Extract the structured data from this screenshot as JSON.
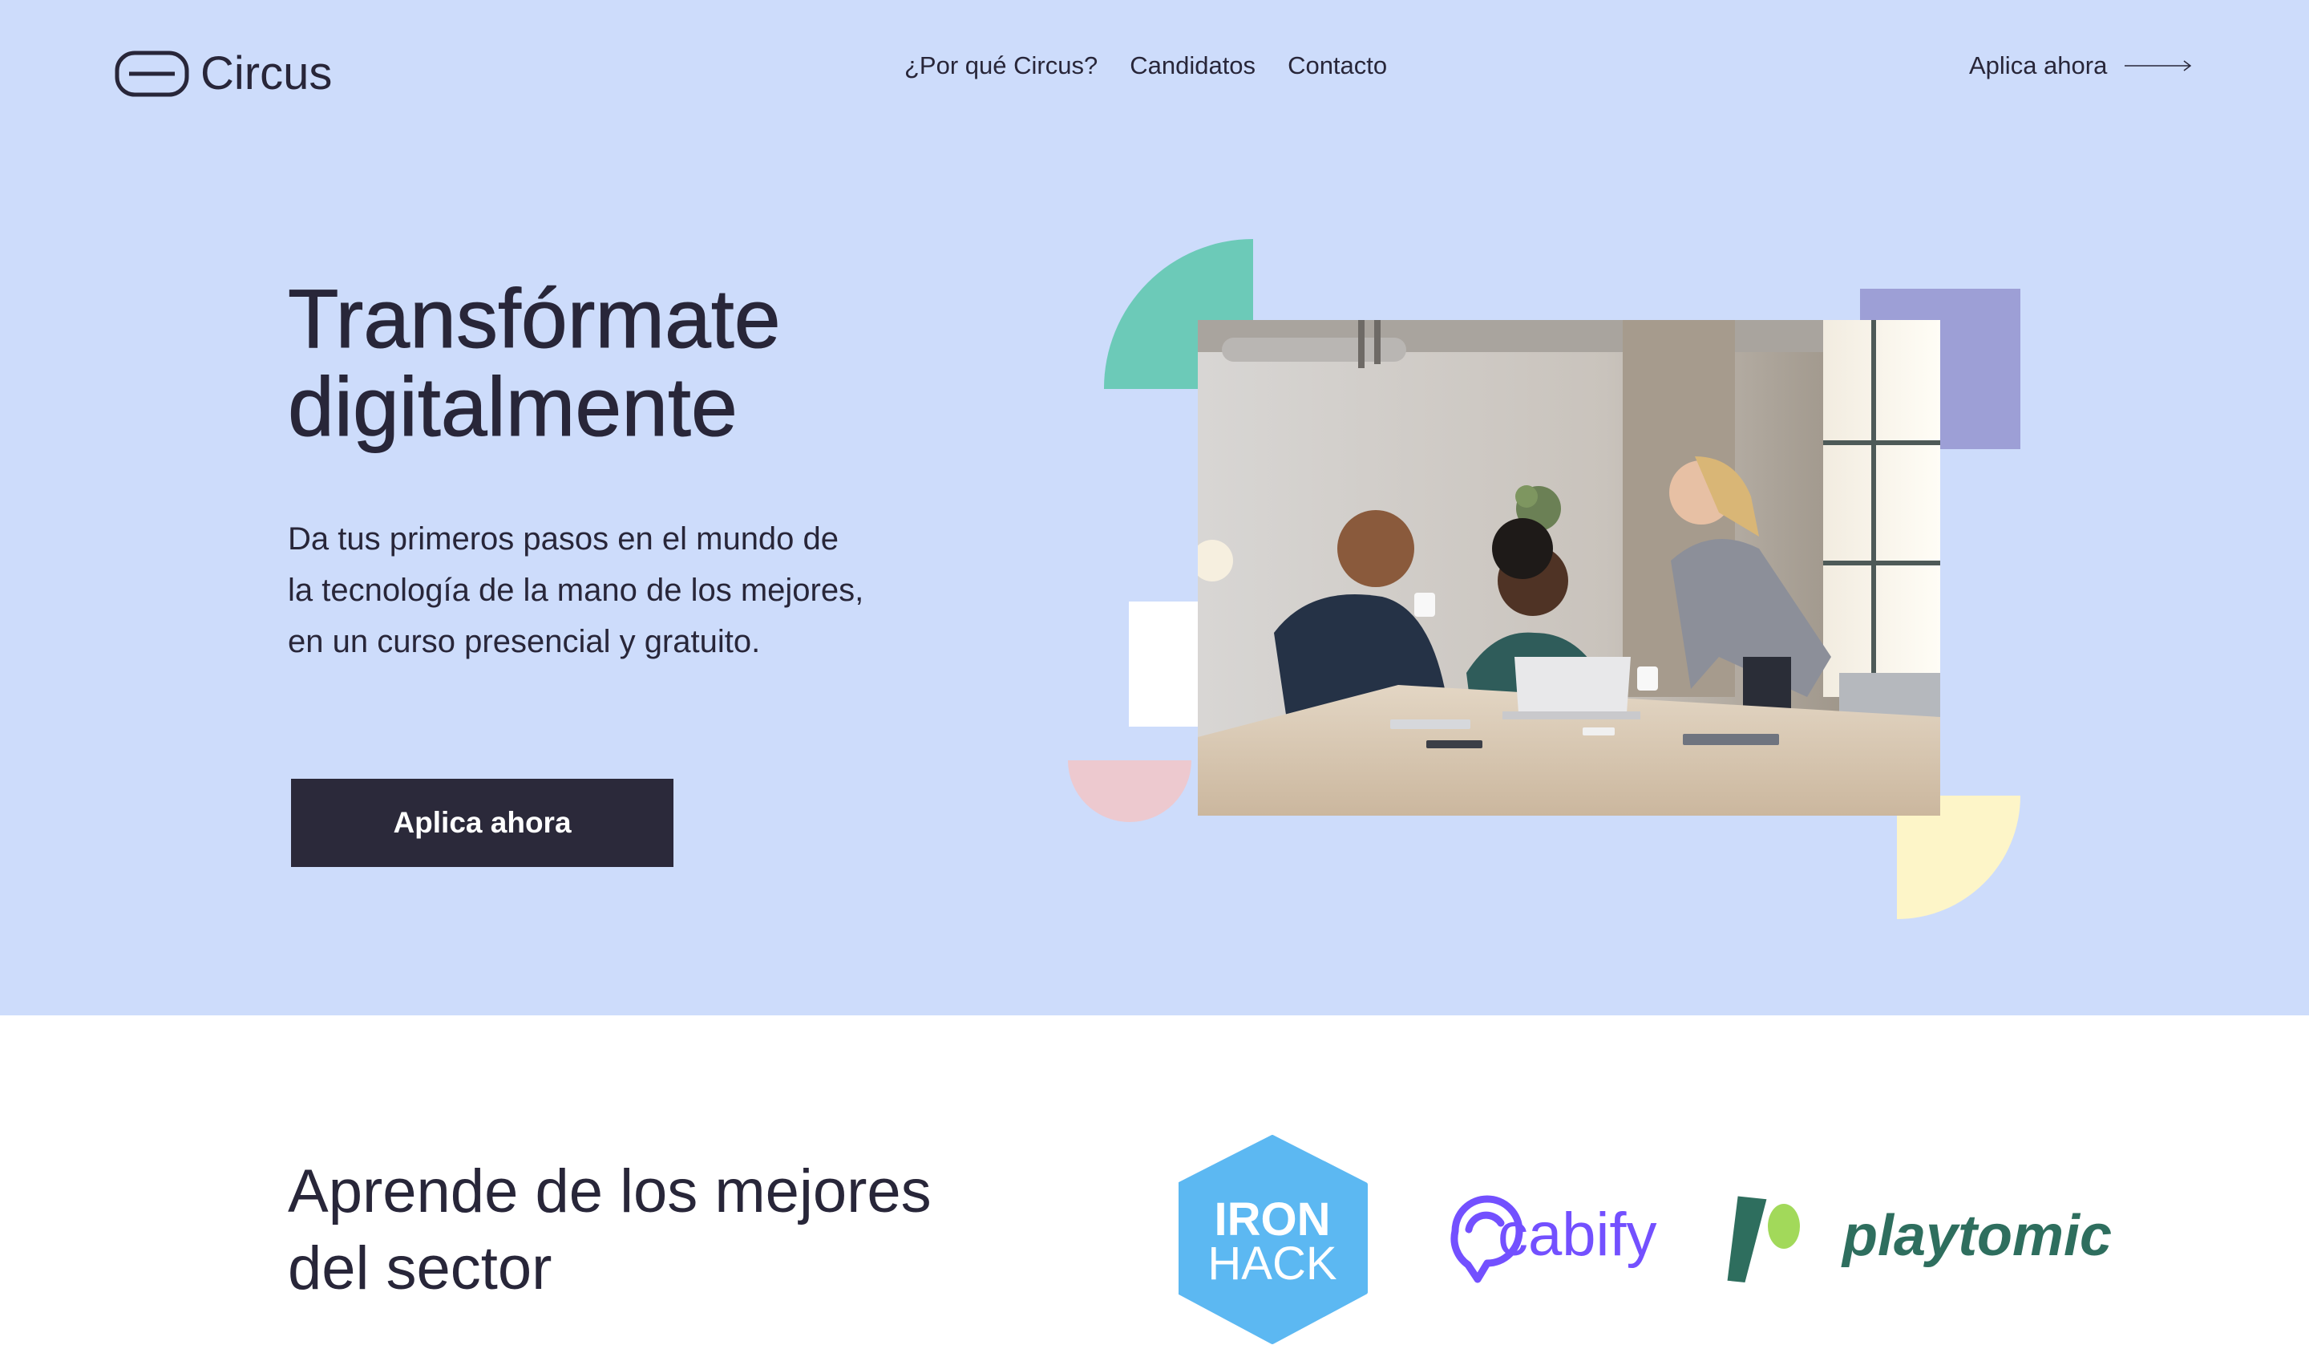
{
  "brand": {
    "name": "Circus"
  },
  "nav": {
    "items": [
      {
        "label": "¿Por qué Circus?"
      },
      {
        "label": "Candidatos"
      },
      {
        "label": "Contacto"
      }
    ],
    "cta_label": "Aplica ahora"
  },
  "hero": {
    "title_line1": "Transfórmate",
    "title_line2": "digitalmente",
    "subtitle": "Da tus primeros pasos en el mundo de la tecnología de la mano de los mejores, en un curso presencial y gratuito.",
    "button_label": "Aplica ahora"
  },
  "partners_section": {
    "title_line1": "Aprende de los mejores",
    "title_line2": "del sector",
    "logos": [
      {
        "name": "IRON HACK",
        "line1": "IRON",
        "line2": "HACK"
      },
      {
        "name": "cabify"
      },
      {
        "name": "playtomic"
      }
    ]
  },
  "colors": {
    "hero_bg": "#cddcfb",
    "text_dark": "#282639",
    "button_bg": "#2b293a",
    "teal": "#6ccab8",
    "lavender": "#9d9fd6",
    "pink": "#edc9cf",
    "yellow": "#fdf5c8",
    "ironhack_blue": "#5cb8f2",
    "cabify_purple": "#7350ff",
    "playtomic_green": "#2e6e5e",
    "playtomic_lime": "#a2d95a"
  }
}
